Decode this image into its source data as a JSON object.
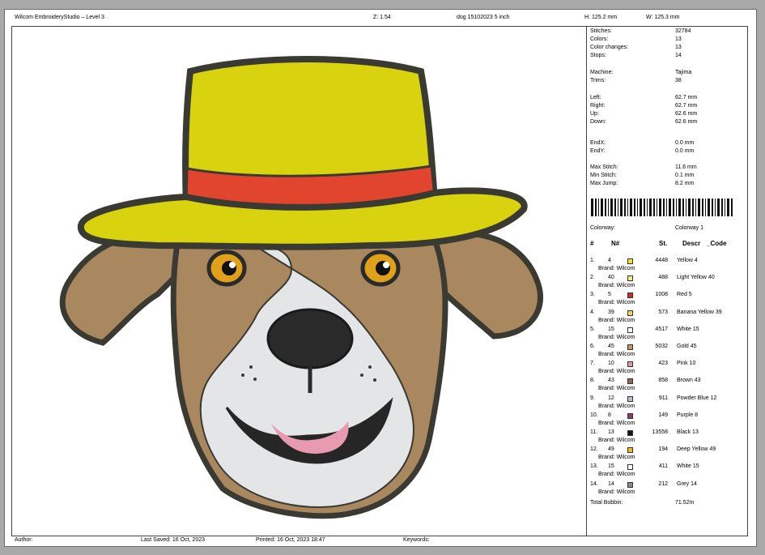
{
  "header": {
    "app": "Wilcom EmbroideryStudio – Level 3",
    "zoom": "Z: 1.54",
    "file": "dog 15102023 5 inch",
    "height": "H: 125.2 mm",
    "width": "W: 125.3 mm"
  },
  "stats": [
    {
      "k": "Stitches:",
      "v": "32784"
    },
    {
      "k": "Colors:",
      "v": "13"
    },
    {
      "k": "Color changes:",
      "v": "13"
    },
    {
      "k": "Stops:",
      "v": "14"
    },
    {
      "k": "Machine:",
      "v": "Tajima"
    },
    {
      "k": "Trims:",
      "v": "38"
    },
    {
      "k": "Left:",
      "v": "62.7 mm"
    },
    {
      "k": "Right:",
      "v": "62.7 mm"
    },
    {
      "k": "Up:",
      "v": "62.6 mm"
    },
    {
      "k": "Down:",
      "v": "62.6 mm"
    },
    {
      "k": "EndX:",
      "v": "0.0 mm"
    },
    {
      "k": "EndY:",
      "v": "0.0 mm"
    },
    {
      "k": "Max Stitch:",
      "v": "11.6 mm"
    },
    {
      "k": "Min Stitch:",
      "v": "0.1 mm"
    },
    {
      "k": "Max Jump:",
      "v": "8.2 mm"
    }
  ],
  "colorway": {
    "label": "Colorway:",
    "value": "Colorway 1"
  },
  "table_headers": {
    "num": "#",
    "n": "N#",
    "st": "St.",
    "descr": "Descr",
    "code": "_Code"
  },
  "colors": [
    {
      "idx": "1.",
      "n": "4",
      "st": "4448",
      "descr": "Yellow 4",
      "brand": "Brand: Wilcom",
      "hex": "#f4e81c"
    },
    {
      "idx": "2.",
      "n": "40",
      "st": "488",
      "descr": "Light Yellow 40",
      "brand": "Brand: Wilcom",
      "hex": "#f2ef86"
    },
    {
      "idx": "3.",
      "n": "5",
      "st": "1008",
      "descr": "Red 5",
      "brand": "Brand: Wilcom",
      "hex": "#d42a22"
    },
    {
      "idx": "4.",
      "n": "39",
      "st": "573",
      "descr": "Banana Yellow 39",
      "brand": "Brand: Wilcom",
      "hex": "#f4d55a"
    },
    {
      "idx": "5.",
      "n": "15",
      "st": "4517",
      "descr": "White 15",
      "brand": "Brand: Wilcom",
      "hex": "#ffffff"
    },
    {
      "idx": "6.",
      "n": "45",
      "st": "5032",
      "descr": "Gold 45",
      "brand": "Brand: Wilcom",
      "hex": "#c39a5e"
    },
    {
      "idx": "7.",
      "n": "10",
      "st": "423",
      "descr": "Pink 10",
      "brand": "Brand: Wilcom",
      "hex": "#e89a9a"
    },
    {
      "idx": "8.",
      "n": "43",
      "st": "858",
      "descr": "Brown 43",
      "brand": "Brand: Wilcom",
      "hex": "#8e6a4a"
    },
    {
      "idx": "9.",
      "n": "12",
      "st": "911",
      "descr": "Powder Blue 12",
      "brand": "Brand: Wilcom",
      "hex": "#b8bfd6"
    },
    {
      "idx": "10.",
      "n": "8",
      "st": "149",
      "descr": "Purple 8",
      "brand": "Brand: Wilcom",
      "hex": "#8a3c6e"
    },
    {
      "idx": "11.",
      "n": "13",
      "st": "13558",
      "descr": "Black 13",
      "brand": "Brand: Wilcom",
      "hex": "#141414"
    },
    {
      "idx": "12.",
      "n": "49",
      "st": "194",
      "descr": "Deep Yellow 49",
      "brand": "Brand: Wilcom",
      "hex": "#f2b81c"
    },
    {
      "idx": "13.",
      "n": "15",
      "st": "411",
      "descr": "White 15",
      "brand": "Brand: Wilcom",
      "hex": "#ffffff"
    },
    {
      "idx": "14.",
      "n": "14",
      "st": "212",
      "descr": "Grey 14",
      "brand": "Brand: Wilcom",
      "hex": "#8a8a8a"
    }
  ],
  "total_bobbin": {
    "label": "Total Bobbin:",
    "value": "71.52m"
  },
  "footer": {
    "author": "Author:",
    "saved": "Last Saved: 16 Oct, 2023",
    "printed": "Printed: 16 Oct, 2023 18:47",
    "keywords": "Keywords:"
  }
}
